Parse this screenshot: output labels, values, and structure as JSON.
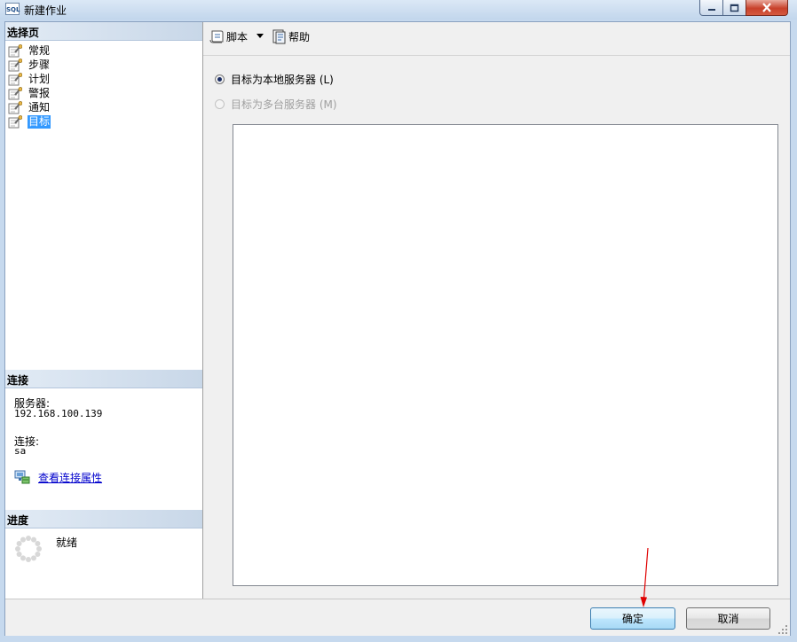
{
  "window": {
    "title": "新建作业",
    "icon_text": "SQL"
  },
  "left": {
    "select_page_header": "选择页",
    "pages": [
      {
        "label": "常规"
      },
      {
        "label": "步骤"
      },
      {
        "label": "计划"
      },
      {
        "label": "警报"
      },
      {
        "label": "通知"
      },
      {
        "label": "目标",
        "selected": true
      }
    ],
    "connection_header": "连接",
    "server_label": "服务器:",
    "server_value": "192.168.100.139",
    "connection_label": "连接:",
    "connection_value": "sa",
    "view_props_link": "查看连接属性",
    "progress_header": "进度",
    "progress_status": "就绪"
  },
  "toolbar": {
    "script_label": "脚本",
    "help_label": "帮助"
  },
  "main": {
    "radio_local": "目标为本地服务器 (L)",
    "radio_multi": "目标为多台服务器 (M)"
  },
  "buttons": {
    "ok": "确定",
    "cancel": "取消"
  },
  "colors": {
    "selection": "#3399ff",
    "annotation_arrow": "#e00000"
  }
}
